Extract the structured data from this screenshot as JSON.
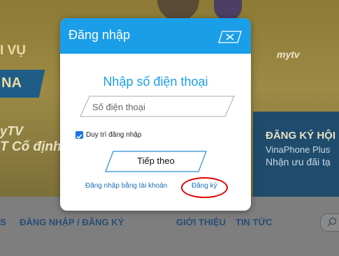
{
  "background": {
    "hero": {
      "text_fragment_1": "I VỤ",
      "text_fragment_2": "NA",
      "text_fragment_3": "yTV",
      "text_fragment_4": "T Cố định",
      "logo_text": "mytv",
      "promo": {
        "line1": "ĐĂNG KÝ HỘI",
        "line2": "VinaPhone Plus",
        "line3": "Nhận ưu đãi tạ"
      }
    },
    "nav": {
      "items": [
        {
          "label": "S"
        },
        {
          "label": "ĐĂNG NHẬP / ĐĂNG KÝ"
        },
        {
          "label": "GIỚI THIỆU"
        },
        {
          "label": "TIN TỨC"
        }
      ]
    }
  },
  "modal": {
    "title": "Đăng nhập",
    "heading": "Nhập số điện thoại",
    "phone_placeholder": "Số điện thoại",
    "remember_label": "Duy trì đăng nhập",
    "remember_checked": true,
    "next_label": "Tiếp theo",
    "login_with_account_label": "Đăng nhập bằng tài khoản",
    "register_label": "Đăng ký"
  },
  "colors": {
    "header_blue": "#1b9ee8",
    "link_blue": "#1b6fb8",
    "highlight_red": "#e00000"
  }
}
